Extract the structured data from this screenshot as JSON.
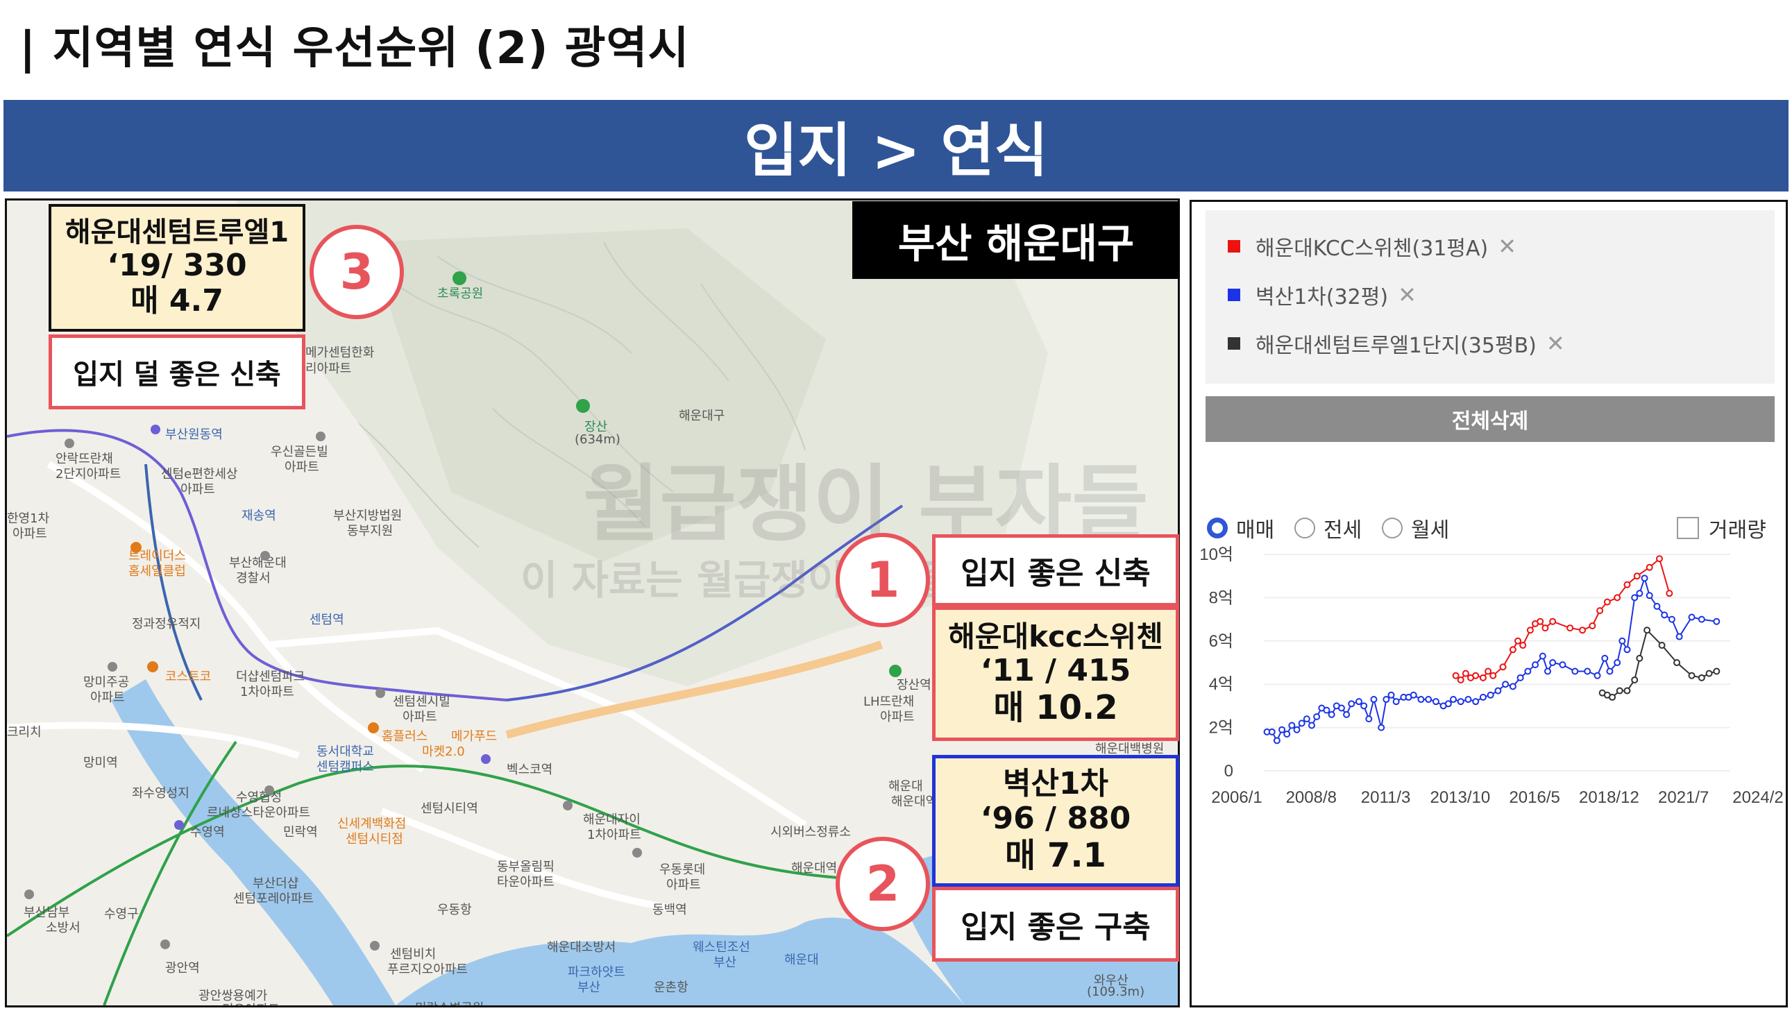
{
  "page": {
    "title": "| 지역별 연식 우선순위 (2) 광역시",
    "banner": "입지 > 연식"
  },
  "map": {
    "region": "부산 해운대구",
    "watermark_main": "월급쟁이 부자들",
    "watermark_sub": "이 자료는 월급쟁이부자들의 소중한 자산입니다",
    "places": [
      "초록공원",
      "메가센텀한화",
      "리아파트",
      "부산원동역",
      "우신골든빌",
      "아파트",
      "안락뜨란채",
      "2단지아파트",
      "센텀e편한세상",
      "아파트",
      "재송역",
      "부산지방법원",
      "동부지원",
      "한영1차",
      "아파트",
      "트레이더스",
      "홈세일클럽",
      "부산해운대",
      "경찰서",
      "센텀역",
      "정과정유적지",
      "망미주공",
      "아파트",
      "코스트코",
      "더샵센텀파크",
      "1차아파트",
      "센텀센시빌",
      "아파트",
      "홈플러스",
      "메가푸드",
      "마켓2.0",
      "동서대학교",
      "센텀캠퍼스",
      "벡스코역",
      "크리치",
      "망미역",
      "좌수영성지",
      "수영협성",
      "르네상스타운아파트",
      "민락역",
      "센텀시티역",
      "신세계백화점",
      "센텀시티점",
      "수영역",
      "해운대자이",
      "1차아파트",
      "동부올림픽",
      "타운아파트",
      "우동롯데",
      "아파트",
      "부산더샵",
      "센텀포레아파트",
      "수영구",
      "부산남부",
      "소방서",
      "우동항",
      "동백역",
      "해운대소방서",
      "웨스틴조선",
      "부산",
      "해운대",
      "센텀비치",
      "푸르지오아파트",
      "파크하얏트",
      "부산",
      "운촌항",
      "광안역",
      "광안쌍용예가",
      "디오아파트",
      "와우산",
      "(109.3m)",
      "민락수변공원",
      "장산",
      "(634m)",
      "해운대구",
      "장산역",
      "LH뜨란채",
      "아파트",
      "해운대",
      "시외버스정류소",
      "해운대역",
      "해운대역",
      "해운대백병원"
    ]
  },
  "annotations": {
    "card3": {
      "name": "해운대센텀트루엘1",
      "spec": "‘19/ 330",
      "price": "매 4.7"
    },
    "label3": "입지 덜 좋은 신축",
    "num3": "3",
    "label1": "입지 좋은 신축",
    "num1": "1",
    "card1": {
      "name": "해운대kcc스위첸",
      "spec": "‘11 / 415",
      "price": "매 10.2"
    },
    "card2": {
      "name": "벽산1차",
      "spec": "‘96 / 880",
      "price": "매 7.1"
    },
    "num2": "2",
    "label2": "입지 좋은 구축"
  },
  "panel": {
    "legend": [
      {
        "label": "해운대KCC스위첸(31평A)",
        "color": "#ee1111"
      },
      {
        "label": "벽산1차(32평)",
        "color": "#1b33e6"
      },
      {
        "label": "해운대센텀트루엘1단지(35평B)",
        "color": "#333333"
      }
    ],
    "remove_glyph": "✕",
    "delete_all": "전체삭제",
    "radios": [
      {
        "label": "매매",
        "selected": true
      },
      {
        "label": "전세",
        "selected": false
      },
      {
        "label": "월세",
        "selected": false
      }
    ],
    "volume_checkbox": "거래량"
  },
  "chart_data": {
    "type": "line",
    "ylim": [
      0,
      10
    ],
    "y_ticks": [
      "0",
      "2억",
      "4억",
      "6억",
      "8억",
      "10억"
    ],
    "x_ticks": [
      "2006/1",
      "2008/8",
      "2011/3",
      "2013/10",
      "2016/5",
      "2018/12",
      "2021/7",
      "2024/2"
    ],
    "x_range": [
      2006.0,
      2024.75
    ],
    "series": [
      {
        "name": "해운대KCC스위첸(31평A)",
        "color": "#ee1111",
        "points": [
          [
            2013.7,
            4.4
          ],
          [
            2013.9,
            4.2
          ],
          [
            2014.1,
            4.5
          ],
          [
            2014.3,
            4.3
          ],
          [
            2014.5,
            4.4
          ],
          [
            2014.8,
            4.3
          ],
          [
            2015.0,
            4.6
          ],
          [
            2015.2,
            4.4
          ],
          [
            2015.6,
            4.8
          ],
          [
            2016.0,
            5.6
          ],
          [
            2016.2,
            6.0
          ],
          [
            2016.4,
            5.8
          ],
          [
            2016.7,
            6.5
          ],
          [
            2016.9,
            6.8
          ],
          [
            2017.1,
            6.9
          ],
          [
            2017.3,
            6.6
          ],
          [
            2017.6,
            6.9
          ],
          [
            2018.3,
            6.6
          ],
          [
            2018.8,
            6.5
          ],
          [
            2019.2,
            6.7
          ],
          [
            2019.5,
            7.4
          ],
          [
            2019.8,
            7.8
          ],
          [
            2020.2,
            8.0
          ],
          [
            2020.6,
            8.6
          ],
          [
            2021.0,
            9.0
          ],
          [
            2021.5,
            9.4
          ],
          [
            2021.9,
            9.8
          ],
          [
            2022.3,
            8.2
          ]
        ]
      },
      {
        "name": "벽산1차(32평)",
        "color": "#1b33e6",
        "points": [
          [
            2006.1,
            1.8
          ],
          [
            2006.3,
            1.8
          ],
          [
            2006.5,
            1.4
          ],
          [
            2006.7,
            1.9
          ],
          [
            2006.9,
            1.7
          ],
          [
            2007.1,
            2.1
          ],
          [
            2007.3,
            1.9
          ],
          [
            2007.5,
            2.2
          ],
          [
            2007.7,
            2.4
          ],
          [
            2007.9,
            2.1
          ],
          [
            2008.1,
            2.5
          ],
          [
            2008.3,
            2.9
          ],
          [
            2008.5,
            2.8
          ],
          [
            2008.7,
            2.6
          ],
          [
            2008.9,
            3.0
          ],
          [
            2009.1,
            2.9
          ],
          [
            2009.3,
            2.6
          ],
          [
            2009.5,
            3.1
          ],
          [
            2009.8,
            3.2
          ],
          [
            2010.0,
            3.0
          ],
          [
            2010.2,
            2.4
          ],
          [
            2010.4,
            3.3
          ],
          [
            2010.7,
            2.0
          ],
          [
            2010.9,
            3.3
          ],
          [
            2011.1,
            3.5
          ],
          [
            2011.3,
            3.2
          ],
          [
            2011.6,
            3.4
          ],
          [
            2011.8,
            3.4
          ],
          [
            2012.0,
            3.5
          ],
          [
            2012.3,
            3.3
          ],
          [
            2012.6,
            3.3
          ],
          [
            2012.9,
            3.2
          ],
          [
            2013.2,
            3.0
          ],
          [
            2013.4,
            3.1
          ],
          [
            2013.6,
            3.3
          ],
          [
            2013.9,
            3.2
          ],
          [
            2014.2,
            3.3
          ],
          [
            2014.5,
            3.2
          ],
          [
            2014.8,
            3.4
          ],
          [
            2015.1,
            3.5
          ],
          [
            2015.4,
            3.7
          ],
          [
            2015.7,
            4.0
          ],
          [
            2016.0,
            3.9
          ],
          [
            2016.3,
            4.3
          ],
          [
            2016.6,
            4.6
          ],
          [
            2016.9,
            4.9
          ],
          [
            2017.2,
            5.3
          ],
          [
            2017.4,
            4.6
          ],
          [
            2017.6,
            5.0
          ],
          [
            2018.0,
            4.9
          ],
          [
            2018.5,
            4.6
          ],
          [
            2019.0,
            4.6
          ],
          [
            2019.4,
            4.4
          ],
          [
            2019.7,
            5.2
          ],
          [
            2019.9,
            4.6
          ],
          [
            2020.2,
            5.0
          ],
          [
            2020.4,
            6.0
          ],
          [
            2020.6,
            5.6
          ],
          [
            2020.9,
            8.0
          ],
          [
            2021.1,
            8.2
          ],
          [
            2021.3,
            8.9
          ],
          [
            2021.5,
            8.1
          ],
          [
            2021.8,
            7.6
          ],
          [
            2022.1,
            7.2
          ],
          [
            2022.4,
            7.0
          ],
          [
            2022.7,
            6.2
          ],
          [
            2023.2,
            7.1
          ],
          [
            2023.6,
            7.0
          ],
          [
            2024.2,
            6.9
          ]
        ]
      },
      {
        "name": "해운대센텀트루엘1단지(35평B)",
        "color": "#333333",
        "points": [
          [
            2019.6,
            3.6
          ],
          [
            2019.8,
            3.5
          ],
          [
            2020.0,
            3.4
          ],
          [
            2020.3,
            3.7
          ],
          [
            2020.6,
            3.7
          ],
          [
            2020.9,
            4.2
          ],
          [
            2021.1,
            5.2
          ],
          [
            2021.4,
            6.5
          ],
          [
            2022.0,
            5.8
          ],
          [
            2022.6,
            5.0
          ],
          [
            2023.2,
            4.4
          ],
          [
            2023.6,
            4.3
          ],
          [
            2023.9,
            4.5
          ],
          [
            2024.2,
            4.6
          ]
        ]
      }
    ]
  }
}
